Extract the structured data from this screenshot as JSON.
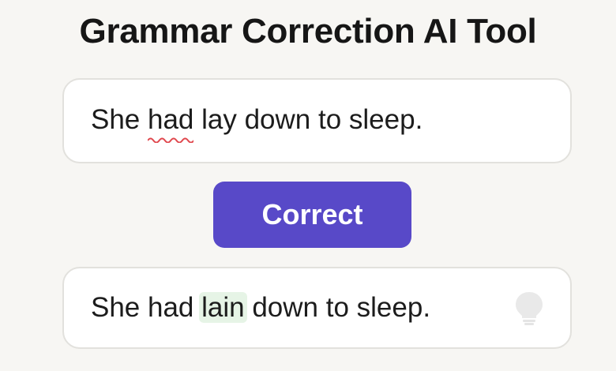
{
  "page": {
    "title": "Grammar Correction AI Tool"
  },
  "input": {
    "before": "She ",
    "flagged_word": "had",
    "after": " lay down to sleep."
  },
  "action": {
    "correct_label": "Correct"
  },
  "output": {
    "before": "She had ",
    "fixed_word": "lain",
    "after": " down to sleep.",
    "hint_icon": "lightbulb-icon"
  },
  "colors": {
    "background": "#f7f6f3",
    "button": "#5849c8",
    "error_underline": "#e0484e",
    "fix_highlight": "#e6f4e6",
    "bulb": "#e7e7e7"
  }
}
